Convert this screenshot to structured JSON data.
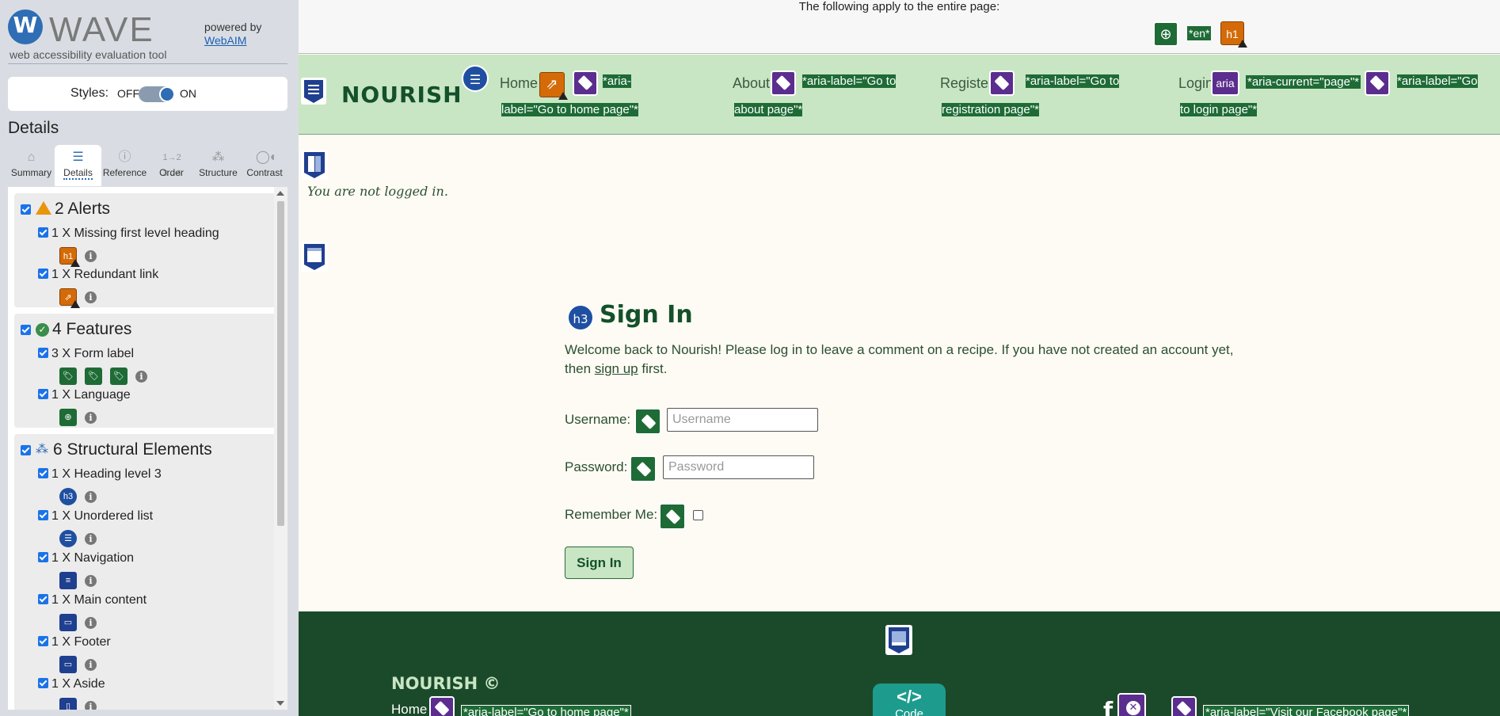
{
  "wave": {
    "logo_text": "WAVE",
    "tagline": "web accessibility evaluation tool",
    "powered_by": "powered by",
    "webaim": "WebAIM",
    "styles_label": "Styles:",
    "styles_off": "OFF",
    "styles_on": "ON",
    "details_heading": "Details",
    "tabs": [
      {
        "label": "Summary",
        "icon": "home-icon"
      },
      {
        "label": "Details",
        "icon": "list-icon"
      },
      {
        "label": "Reference",
        "icon": "info-icon"
      },
      {
        "label": "Order",
        "icon": "order-icon"
      },
      {
        "label": "Structure",
        "icon": "structure-icon"
      },
      {
        "label": "Contrast",
        "icon": "contrast-icon"
      }
    ],
    "alerts": {
      "title": "2 Alerts",
      "items": [
        "1 X Missing first level heading",
        "1 X Redundant link"
      ]
    },
    "features": {
      "title": "4 Features",
      "items": [
        "3 X Form label",
        "1 X Language"
      ]
    },
    "structure": {
      "title": "6 Structural Elements",
      "items": [
        "1 X Heading level 3",
        "1 X Unordered list",
        "1 X Navigation",
        "1 X Main content",
        "1 X Footer",
        "1 X Aside"
      ]
    },
    "icon_texts": {
      "h1": "h1",
      "h3": "h3",
      "aria": "aria",
      "en": "*en*",
      "info": "i"
    }
  },
  "page": {
    "applies_text": "The following apply to the entire page:",
    "brand": "NOURISH",
    "nav": [
      {
        "label": "Home",
        "aria": "*aria-label=\"Go to home page\"*"
      },
      {
        "label": "About",
        "aria": "*aria-label=\"Go to about page\"*"
      },
      {
        "label": "Register",
        "aria": "*aria-label=\"Go to registration page\"*"
      },
      {
        "label": "Login",
        "aria_current": "*aria-current=\"page\"*",
        "aria": "*aria-label=\"Go to login page\"*"
      }
    ],
    "not_logged_in": "You are not logged in.",
    "signin_title": "Sign In",
    "welcome_1": "Welcome back to Nourish! Please log in to leave a comment on a recipe. If you have not created an account yet, then ",
    "sign_up_link": "sign up",
    "welcome_2": " first.",
    "username_label": "Username:",
    "username_placeholder": "Username",
    "password_label": "Password:",
    "password_placeholder": "Password",
    "remember_label": "Remember Me:",
    "signin_button": "Sign In",
    "footer_brand": "NOURISH ©",
    "footer_home": "Home",
    "footer_home_aria": "*aria-label=\"Go to home page\"*",
    "footer_code_symbol": "</>",
    "footer_code_label": "Code",
    "footer_fb_letter": "f",
    "footer_fb_aria": "*aria-label=\"Visit our Facebook page\"*"
  },
  "colors": {
    "wave_blue": "#2f6db5",
    "nav_green": "#c8e6c4",
    "brand_green": "#14502a",
    "footer_green": "#1b4a2a",
    "label_purple": "#5b2d8e",
    "feature_green": "#1e6b36",
    "alert_orange": "#d46b08"
  }
}
